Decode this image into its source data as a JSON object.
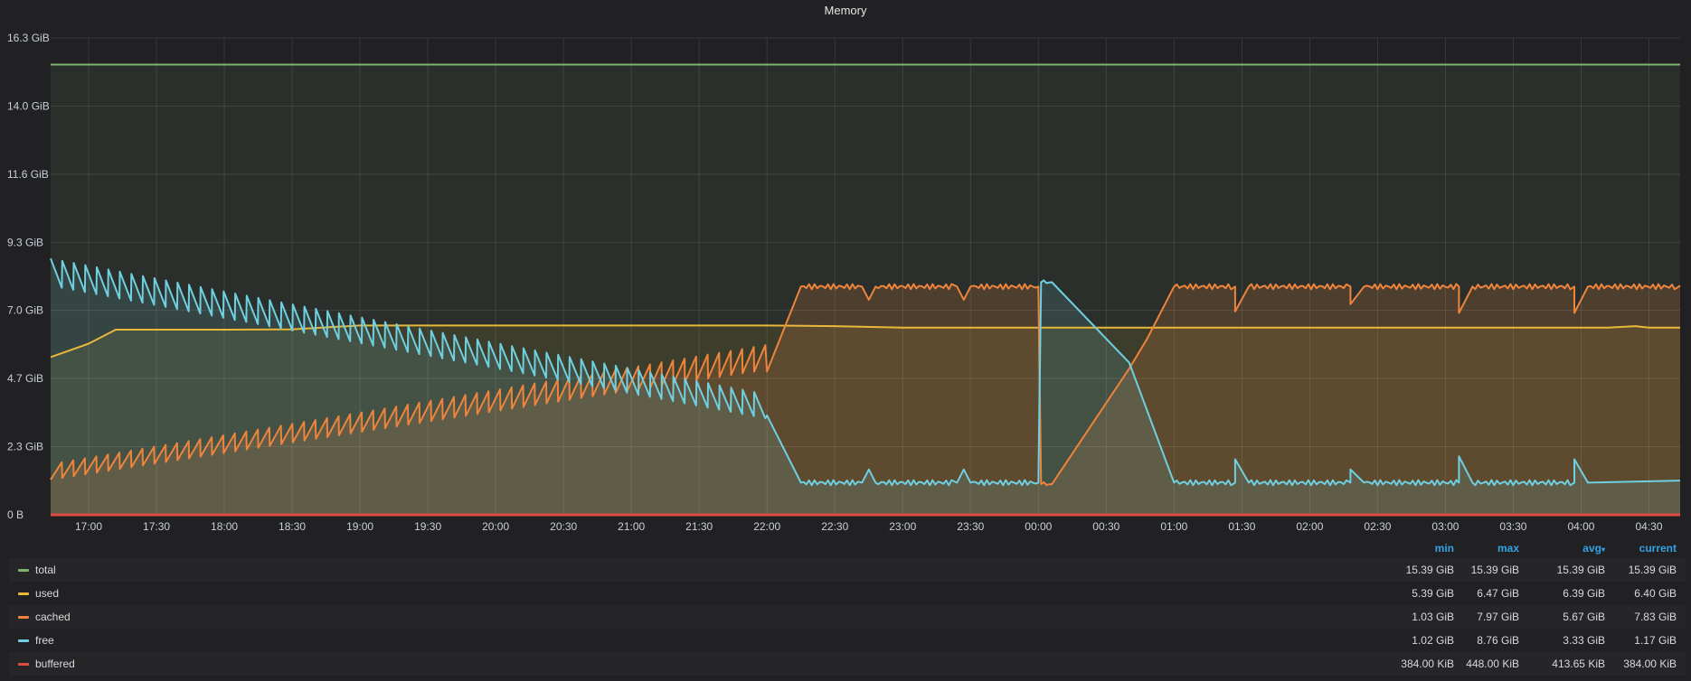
{
  "panel": {
    "title": "Memory"
  },
  "legend": {
    "columns": {
      "min": "min",
      "max": "max",
      "avg": "avg",
      "current": "current"
    },
    "rows": [
      {
        "name": "total",
        "color": "#7eb26d",
        "min": "15.39 GiB",
        "max": "15.39 GiB",
        "avg": "15.39 GiB",
        "current": "15.39 GiB"
      },
      {
        "name": "used",
        "color": "#eab839",
        "min": "5.39 GiB",
        "max": "6.47 GiB",
        "avg": "6.39 GiB",
        "current": "6.40 GiB"
      },
      {
        "name": "cached",
        "color": "#ef843c",
        "min": "1.03 GiB",
        "max": "7.97 GiB",
        "avg": "5.67 GiB",
        "current": "7.83 GiB"
      },
      {
        "name": "free",
        "color": "#6ed0e0",
        "min": "1.02 GiB",
        "max": "8.76 GiB",
        "avg": "3.33 GiB",
        "current": "1.17 GiB"
      },
      {
        "name": "buffered",
        "color": "#e24d42",
        "min": "384.00 KiB",
        "max": "448.00 KiB",
        "avg": "413.65 KiB",
        "current": "384.00 KiB"
      }
    ]
  },
  "chart_data": {
    "type": "area",
    "title": "Memory",
    "xlabel": "",
    "ylabel": "",
    "x_ticks": [
      "17:00",
      "17:30",
      "18:00",
      "18:30",
      "19:00",
      "19:30",
      "20:00",
      "20:30",
      "21:00",
      "21:30",
      "22:00",
      "22:30",
      "23:00",
      "23:30",
      "00:00",
      "00:30",
      "01:00",
      "01:30",
      "02:00",
      "02:30",
      "03:00",
      "03:30",
      "04:00",
      "04:30"
    ],
    "y_ticks": [
      {
        "value": 0,
        "label": "0 B"
      },
      {
        "value": 2.33,
        "label": "2.3 GiB"
      },
      {
        "value": 4.66,
        "label": "4.7 GiB"
      },
      {
        "value": 6.99,
        "label": "7.0 GiB"
      },
      {
        "value": 9.31,
        "label": "9.3 GiB"
      },
      {
        "value": 11.64,
        "label": "11.6 GiB"
      },
      {
        "value": 13.97,
        "label": "14.0 GiB"
      },
      {
        "value": 16.3,
        "label": "16.3 GiB"
      }
    ],
    "x_range_hours": [
      16.72,
      28.73
    ],
    "ylim": [
      0,
      16.3
    ],
    "grid": true,
    "legend_placement": "bottom",
    "series": [
      {
        "name": "total",
        "color": "#7eb26d",
        "points": [
          [
            16.72,
            15.39
          ],
          [
            28.73,
            15.39
          ]
        ]
      },
      {
        "name": "used",
        "color": "#eab839",
        "points": [
          [
            16.72,
            5.39
          ],
          [
            17.0,
            5.85
          ],
          [
            17.2,
            6.33
          ],
          [
            17.5,
            6.33
          ],
          [
            18.0,
            6.33
          ],
          [
            18.5,
            6.34
          ],
          [
            19.0,
            6.47
          ],
          [
            20.0,
            6.47
          ],
          [
            21.0,
            6.47
          ],
          [
            22.0,
            6.47
          ],
          [
            22.5,
            6.45
          ],
          [
            23.0,
            6.4
          ],
          [
            24.0,
            6.4
          ],
          [
            25.0,
            6.4
          ],
          [
            26.0,
            6.4
          ],
          [
            27.0,
            6.4
          ],
          [
            28.2,
            6.4
          ],
          [
            28.4,
            6.45
          ],
          [
            28.5,
            6.4
          ],
          [
            28.73,
            6.4
          ]
        ]
      },
      {
        "name": "cached",
        "color": "#ef843c",
        "sawtooth": {
          "start": 16.72,
          "end": 22.0,
          "period": 0.085,
          "low_start": 1.2,
          "low_end": 4.9,
          "amp_start": 0.6,
          "amp_end": 0.9
        },
        "points": [
          [
            22.0,
            4.9
          ],
          [
            22.25,
            7.8
          ],
          [
            22.7,
            7.8
          ],
          [
            22.75,
            7.35
          ],
          [
            22.8,
            7.8
          ],
          [
            23.4,
            7.8
          ],
          [
            23.45,
            7.35
          ],
          [
            23.5,
            7.8
          ],
          [
            24.0,
            7.8
          ],
          [
            24.02,
            1.05
          ],
          [
            24.1,
            1.05
          ],
          [
            24.67,
            5.0
          ],
          [
            24.8,
            6.0
          ],
          [
            25.0,
            7.8
          ],
          [
            25.45,
            7.8
          ],
          [
            25.45,
            6.95
          ],
          [
            25.55,
            7.8
          ],
          [
            26.3,
            7.8
          ],
          [
            26.3,
            7.2
          ],
          [
            26.4,
            7.8
          ],
          [
            27.1,
            7.8
          ],
          [
            27.1,
            6.9
          ],
          [
            27.2,
            7.8
          ],
          [
            27.95,
            7.8
          ],
          [
            27.95,
            6.9
          ],
          [
            28.05,
            7.8
          ],
          [
            28.73,
            7.83
          ]
        ]
      },
      {
        "name": "free",
        "color": "#6ed0e0",
        "sawtooth": {
          "start": 16.72,
          "end": 22.0,
          "period": 0.085,
          "high_start": 8.76,
          "high_end": 4.2,
          "amp_start": 1.0,
          "amp_end": 0.9
        },
        "points": [
          [
            22.0,
            3.4
          ],
          [
            22.25,
            1.1
          ],
          [
            22.7,
            1.1
          ],
          [
            22.75,
            1.55
          ],
          [
            22.8,
            1.1
          ],
          [
            23.4,
            1.1
          ],
          [
            23.45,
            1.55
          ],
          [
            23.5,
            1.1
          ],
          [
            24.0,
            1.1
          ],
          [
            24.02,
            7.95
          ],
          [
            24.1,
            7.95
          ],
          [
            24.67,
            5.2
          ],
          [
            25.0,
            1.1
          ],
          [
            25.45,
            1.1
          ],
          [
            25.45,
            1.9
          ],
          [
            25.55,
            1.1
          ],
          [
            26.3,
            1.1
          ],
          [
            26.3,
            1.55
          ],
          [
            26.4,
            1.1
          ],
          [
            27.1,
            1.1
          ],
          [
            27.1,
            2.0
          ],
          [
            27.2,
            1.1
          ],
          [
            27.95,
            1.1
          ],
          [
            27.95,
            1.9
          ],
          [
            28.05,
            1.1
          ],
          [
            28.73,
            1.17
          ]
        ]
      },
      {
        "name": "buffered",
        "color": "#e24d42",
        "points": [
          [
            16.72,
            0.0004
          ],
          [
            28.73,
            0.0004
          ]
        ]
      }
    ]
  }
}
